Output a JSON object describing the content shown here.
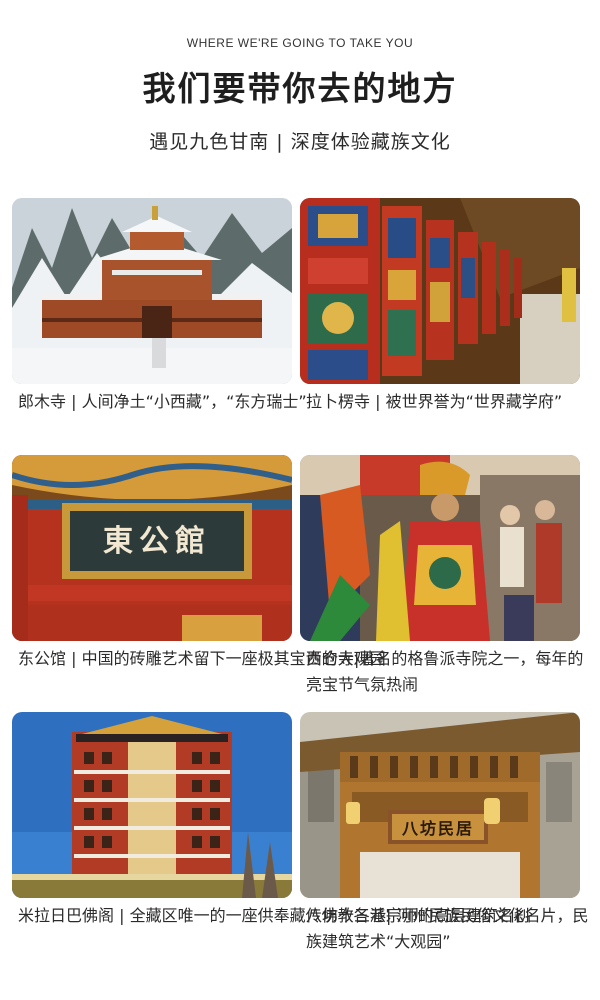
{
  "header": {
    "eyebrow": "WHERE WE'RE GOING TO TAKE YOU",
    "title": "我们要带你去的地方",
    "subtitle": "遇见九色甘南 | 深度体验藏族文化"
  },
  "cards": [
    {
      "caption": "郎木寺 | 人间净土“小西藏”，“东方瑞士”"
    },
    {
      "caption": "拉卜楞寺 | 被世界誉为“世界藏学府”"
    },
    {
      "caption": "东公馆 | 中国的砖雕艺术留下一座极其宝贵的大观园",
      "sign": "東公館"
    },
    {
      "caption": "西仓寺|著名的格鲁派寺院之一，每年的亮宝节气氛热闹"
    },
    {
      "caption": "米拉日巴佛阁 | 全藏区唯一的一座供奉藏传佛教各派宗师的高层建筑名刹"
    },
    {
      "caption": "八坊十三巷| 河州民族民俗文化名片，民族建筑艺术“大观园”",
      "sign": "八坊民居"
    }
  ]
}
